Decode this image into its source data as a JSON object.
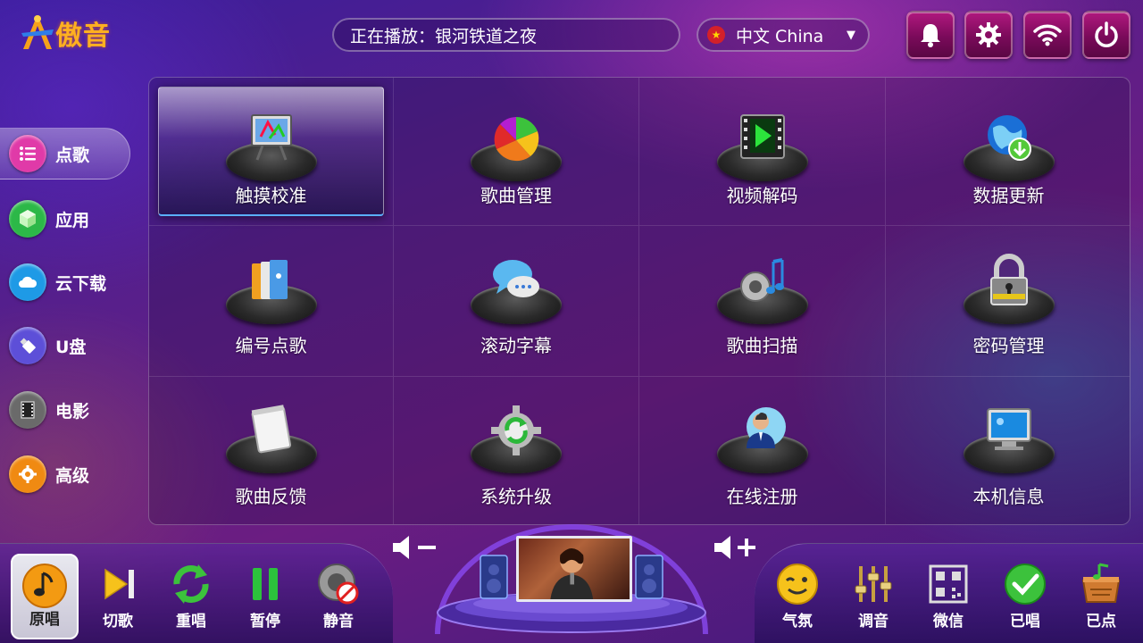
{
  "header": {
    "logo_text": "傲音",
    "now_playing": "正在播放：银河铁道之夜",
    "language": "中文 China"
  },
  "top_buttons": [
    {
      "name": "notification",
      "icon": "bell-icon"
    },
    {
      "name": "settings",
      "icon": "gear-icon"
    },
    {
      "name": "wifi",
      "icon": "wifi-icon"
    },
    {
      "name": "power",
      "icon": "power-icon"
    }
  ],
  "sidebar": {
    "items": [
      {
        "label": "点歌",
        "icon": "list-icon",
        "color": "#e03aa8",
        "active": true
      },
      {
        "label": "应用",
        "icon": "cube-icon",
        "color": "#2cb848"
      },
      {
        "label": "云下载",
        "icon": "cloud-icon",
        "color": "#1e9ae6"
      },
      {
        "label": "U盘",
        "icon": "usb-icon",
        "color": "#5d4fd8"
      },
      {
        "label": "电影",
        "icon": "film-icon",
        "color": "#6a6a6a"
      },
      {
        "label": "高级",
        "icon": "gear-icon",
        "color": "#f08a12"
      }
    ]
  },
  "grid": {
    "items": [
      {
        "label": "触摸校准",
        "icon": "touch-calibration-icon",
        "selected": true
      },
      {
        "label": "歌曲管理",
        "icon": "pie-chart-icon"
      },
      {
        "label": "视频解码",
        "icon": "video-play-icon"
      },
      {
        "label": "数据更新",
        "icon": "globe-download-icon"
      },
      {
        "label": "编号点歌",
        "icon": "folders-icon"
      },
      {
        "label": "滚动字幕",
        "icon": "chat-bubble-icon"
      },
      {
        "label": "歌曲扫描",
        "icon": "speaker-music-icon"
      },
      {
        "label": "密码管理",
        "icon": "padlock-icon"
      },
      {
        "label": "歌曲反馈",
        "icon": "notepad-icon"
      },
      {
        "label": "系统升级",
        "icon": "gear-refresh-icon"
      },
      {
        "label": "在线注册",
        "icon": "user-globe-icon"
      },
      {
        "label": "本机信息",
        "icon": "monitor-icon"
      }
    ]
  },
  "bottom_left": [
    {
      "label": "原唱",
      "icon": "music-note-icon",
      "active": true
    },
    {
      "label": "切歌",
      "icon": "skip-next-icon"
    },
    {
      "label": "重唱",
      "icon": "replay-icon"
    },
    {
      "label": "暂停",
      "icon": "pause-icon"
    },
    {
      "label": "静音",
      "icon": "mute-icon"
    }
  ],
  "bottom_right": [
    {
      "label": "气氛",
      "icon": "wink-face-icon"
    },
    {
      "label": "调音",
      "icon": "equalizer-icon"
    },
    {
      "label": "微信",
      "icon": "qr-code-icon"
    },
    {
      "label": "已唱",
      "icon": "check-icon"
    },
    {
      "label": "已点",
      "icon": "music-box-icon"
    }
  ]
}
